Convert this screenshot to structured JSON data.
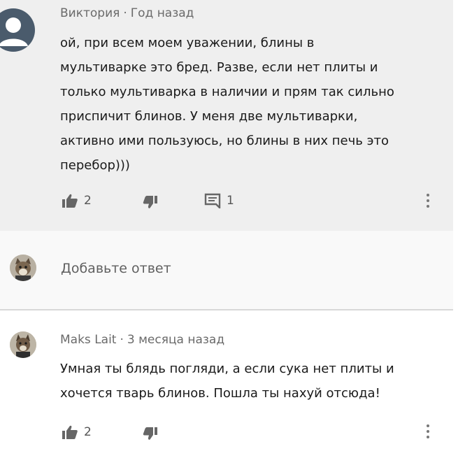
{
  "comments": [
    {
      "author": "Виктория",
      "time": "Год назад",
      "lines": [
        "ой, при всем моем уважении,  блины в",
        "мультиварке это бред. Разве, если нет плиты и",
        "только мультиварка в наличии и прям так сильно",
        "приспичит блинов. У меня две мультиварки,",
        "активно ими пользуюсь, но блины в них печь это",
        "перебор)))"
      ],
      "likes": "2",
      "replies": "1",
      "like_icon": "thumbs-up-icon",
      "dislike_icon": "thumbs-down-icon",
      "reply_icon": "comment-icon",
      "more_icon": "more-vert-icon"
    },
    {
      "author": "Maks Lait",
      "time": "3 месяца назад",
      "lines": [
        "Умная ты блядь погляди, а если сука нет плиты и",
        "хочется тварь блинов.  Пошла ты нахуй отсюда!"
      ],
      "likes": "2",
      "like_icon": "thumbs-up-icon",
      "dislike_icon": "thumbs-down-icon",
      "more_icon": "more-vert-icon"
    }
  ],
  "reply": {
    "placeholder": "Добавьте ответ"
  },
  "colors": {
    "comment_bg": "#efefef",
    "reply_bg": "#f9f9f9",
    "avatar_default": "#4a5b6c",
    "meta_text": "#6a6a6a"
  }
}
